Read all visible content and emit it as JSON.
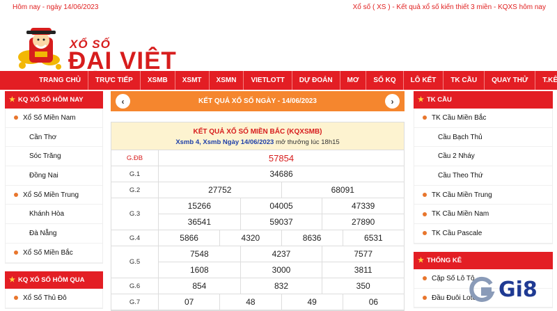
{
  "topbar": {
    "left": "Hôm nay - ngày 14/06/2023",
    "right": "Xổ số ( XS ) - Kết quả xổ số kiến thiết 3 miền - KQXS hôm nay"
  },
  "logo": {
    "small": "XỔ SỐ",
    "big": "ĐẠI VIỆT",
    "mascot_icon": "god-of-wealth-mascot-icon"
  },
  "nav": [
    "TRANG CHỦ",
    "TRỰC TIẾP",
    "XSMB",
    "XSMT",
    "XSMN",
    "VIETLOTT",
    "DỰ ĐOÁN",
    "MƠ",
    "SỐ KQ",
    "LÔ KẾT",
    "TK CẦU",
    "QUAY THỬ",
    "T.KÊ"
  ],
  "left_box": {
    "title": "KQ XỔ SỐ HÔM NAY",
    "items": [
      {
        "label": "Xổ Số Miền Nam",
        "type": "main"
      },
      {
        "label": "Cần Thơ",
        "type": "sub"
      },
      {
        "label": "Sóc Trăng",
        "type": "sub"
      },
      {
        "label": "Đồng Nai",
        "type": "sub"
      },
      {
        "label": "Xổ Số Miền Trung",
        "type": "main"
      },
      {
        "label": "Khánh Hòa",
        "type": "sub"
      },
      {
        "label": "Đà Nẵng",
        "type": "sub"
      },
      {
        "label": "Xổ Số Miền Bắc",
        "type": "main"
      }
    ]
  },
  "left_box2": {
    "title": "KQ XỔ SỐ HÔM QUA",
    "items": [
      {
        "label": "Xổ Số Thủ Đô",
        "type": "main"
      }
    ]
  },
  "result": {
    "header": "KẾT QUẢ XỔ SỐ NGÀY - 14/06/2023",
    "table_title": "KẾT QUẢ XỔ SỐ MIỀN BẮC (KQXSMB)",
    "sub_blue": "Xsmb 4, Xsmb Ngày 14/06/2023",
    "sub_plain": " mở thưởng lúc 18h15",
    "prizes": [
      {
        "label": "G.ĐB",
        "red": true,
        "lines": [
          [
            "57854"
          ]
        ]
      },
      {
        "label": "G.1",
        "lines": [
          [
            "34686"
          ]
        ]
      },
      {
        "label": "G.2",
        "lines": [
          [
            "27752",
            "68091"
          ]
        ]
      },
      {
        "label": "G.3",
        "lines": [
          [
            "15266",
            "04005",
            "47339"
          ],
          [
            "36541",
            "59037",
            "27890"
          ]
        ]
      },
      {
        "label": "G.4",
        "lines": [
          [
            "5866",
            "4320",
            "8636",
            "6531"
          ]
        ]
      },
      {
        "label": "G.5",
        "lines": [
          [
            "7548",
            "4237",
            "7577"
          ],
          [
            "1608",
            "3000",
            "3811"
          ]
        ]
      },
      {
        "label": "G.6",
        "lines": [
          [
            "854",
            "832",
            "350"
          ]
        ]
      },
      {
        "label": "G.7",
        "lines": [
          [
            "07",
            "48",
            "49",
            "06"
          ]
        ]
      }
    ]
  },
  "right_box": {
    "title": "TK CẦU",
    "items": [
      {
        "label": "TK Cầu Miền Bắc",
        "type": "main"
      },
      {
        "label": "Cầu Bạch Thủ",
        "type": "sub"
      },
      {
        "label": "Cầu 2 Nháy",
        "type": "sub"
      },
      {
        "label": "Cầu Theo Thứ",
        "type": "sub"
      },
      {
        "label": "TK Cầu Miền Trung",
        "type": "main"
      },
      {
        "label": "TK Cầu Miền Nam",
        "type": "main"
      },
      {
        "label": "TK Cầu Pascale",
        "type": "main"
      }
    ]
  },
  "right_box2": {
    "title": "THỐNG KÊ",
    "items": [
      {
        "label": "Cặp Số Lô Tô",
        "type": "main"
      },
      {
        "label": "Đầu Đuôi Loto",
        "type": "main"
      }
    ]
  },
  "watermark": {
    "text": "Gi8",
    "icon": "gi8-logo-icon"
  },
  "colors": {
    "brand_red": "#e31e24",
    "orange": "#f5862e",
    "result_bg": "#fdf3d0"
  }
}
